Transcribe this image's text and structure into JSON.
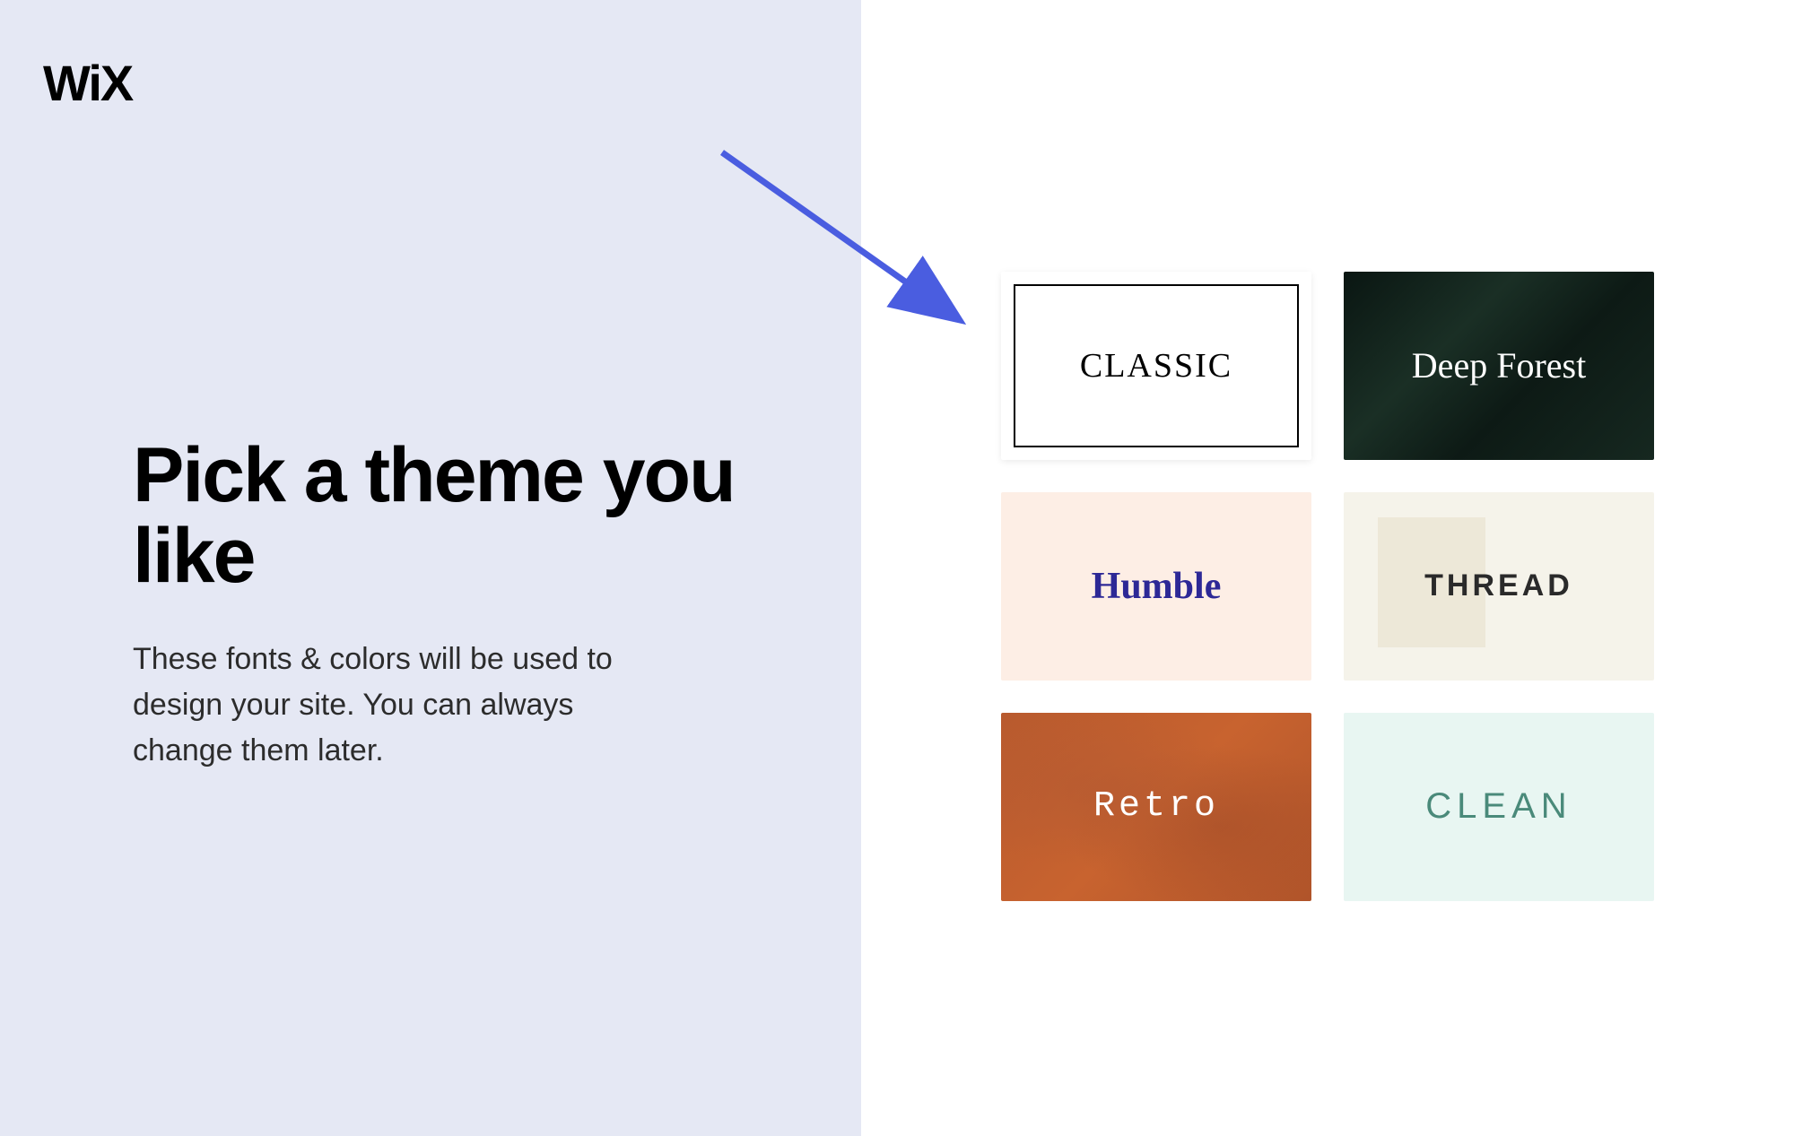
{
  "brand": "WiX",
  "heading": "Pick a theme you like",
  "description": "These fonts & colors will be used to design your site. You can always change them later.",
  "themes": {
    "classic": {
      "label": "CLASSIC"
    },
    "deep_forest": {
      "label": "Deep Forest"
    },
    "humble": {
      "label": "Humble"
    },
    "thread": {
      "label": "THREAD"
    },
    "retro": {
      "label": "Retro"
    },
    "clean": {
      "label": "CLEAN"
    }
  },
  "annotation": {
    "arrow_target": "classic"
  }
}
